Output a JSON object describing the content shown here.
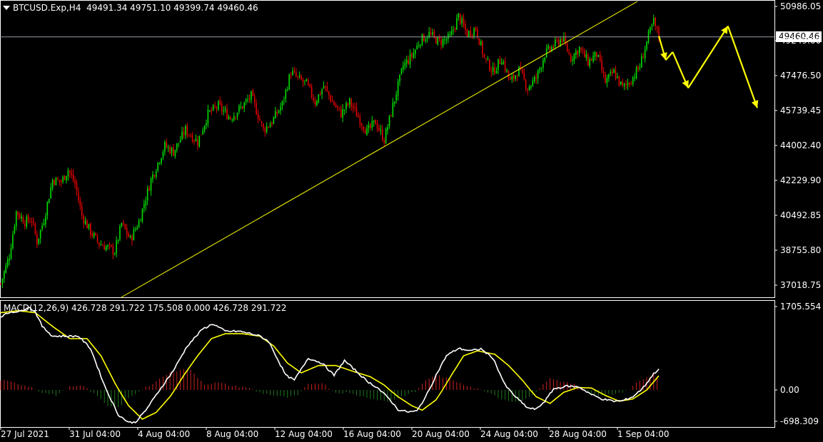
{
  "header": {
    "symbol": "BTCUSD.Exp,H4",
    "ohlc": "49491.34 49751.10 49399.74 49460.46"
  },
  "current_price_label": "49460.46",
  "macd_header": "MACD(12,26,9) 426.728 291.722 175.508 0.000 426.728 291.722",
  "colors": {
    "background": "#000000",
    "bull_candle": "#00e000",
    "bear_candle": "#e00000",
    "trendline": "#ffff00",
    "forecast_arrow": "#ffff00",
    "macd_line": "#ffffff",
    "signal_line": "#ffff00",
    "hist_up": "#cc2222",
    "hist_down": "#1e7a1e",
    "grid_border": "#ffffff"
  },
  "chart_data": [
    {
      "type": "candlestick",
      "title": "BTCUSD.Exp,H4",
      "timeframe": "H4",
      "y_ticks": [
        "50986.05",
        "49249.00",
        "47476.50",
        "45739.45",
        "44002.40",
        "42229.90",
        "40492.85",
        "38755.80",
        "37018.75"
      ],
      "ylim": [
        36600,
        51200
      ],
      "x_ticks": [
        "27 Jul 2021",
        "31 Jul 04:00",
        "4 Aug 04:00",
        "8 Aug 04:00",
        "12 Aug 04:00",
        "16 Aug 04:00",
        "20 Aug 04:00",
        "24 Aug 04:00",
        "28 Aug 04:00",
        "1 Sep 04:00"
      ],
      "anchor_closes": [
        [
          0,
          37100
        ],
        [
          5,
          38500
        ],
        [
          9,
          40700
        ],
        [
          14,
          40200
        ],
        [
          18,
          40300
        ],
        [
          21,
          39200
        ],
        [
          25,
          40300
        ],
        [
          30,
          42300
        ],
        [
          35,
          42200
        ],
        [
          39,
          42800
        ],
        [
          43,
          42100
        ],
        [
          47,
          40500
        ],
        [
          52,
          39700
        ],
        [
          57,
          39100
        ],
        [
          62,
          38900
        ],
        [
          66,
          38700
        ],
        [
          70,
          40100
        ],
        [
          75,
          39300
        ],
        [
          80,
          40200
        ],
        [
          87,
          42300
        ],
        [
          95,
          44000
        ],
        [
          100,
          43700
        ],
        [
          107,
          44800
        ],
        [
          114,
          44200
        ],
        [
          120,
          45600
        ],
        [
          126,
          46000
        ],
        [
          133,
          45400
        ],
        [
          140,
          46000
        ],
        [
          145,
          46500
        ],
        [
          152,
          44800
        ],
        [
          157,
          45200
        ],
        [
          163,
          46100
        ],
        [
          168,
          47700
        ],
        [
          173,
          47300
        ],
        [
          177,
          47100
        ],
        [
          182,
          46200
        ],
        [
          187,
          47000
        ],
        [
          192,
          46200
        ],
        [
          197,
          45600
        ],
        [
          202,
          46200
        ],
        [
          206,
          45600
        ],
        [
          212,
          44700
        ],
        [
          217,
          45200
        ],
        [
          222,
          44300
        ],
        [
          227,
          46000
        ],
        [
          233,
          48000
        ],
        [
          238,
          48500
        ],
        [
          243,
          49300
        ],
        [
          248,
          49600
        ],
        [
          254,
          49200
        ],
        [
          260,
          49400
        ],
        [
          265,
          50500
        ],
        [
          270,
          49600
        ],
        [
          275,
          49900
        ],
        [
          280,
          48400
        ],
        [
          285,
          47700
        ],
        [
          290,
          48400
        ],
        [
          295,
          47200
        ],
        [
          300,
          47800
        ],
        [
          305,
          46900
        ],
        [
          310,
          47400
        ],
        [
          315,
          48600
        ],
        [
          320,
          49000
        ],
        [
          325,
          49400
        ],
        [
          330,
          48400
        ],
        [
          335,
          48900
        ],
        [
          340,
          48200
        ],
        [
          345,
          48600
        ],
        [
          350,
          47200
        ],
        [
          355,
          47700
        ],
        [
          360,
          46900
        ],
        [
          365,
          47300
        ],
        [
          370,
          48000
        ],
        [
          375,
          49500
        ],
        [
          378,
          50200
        ],
        [
          381,
          49460
        ]
      ],
      "trendline": {
        "from": [
          "27 Jul 2021",
          36400
        ],
        "to": [
          "1 Sep 04:00",
          51500
        ]
      },
      "forecast_path": [
        [
          381,
          49500
        ],
        [
          385,
          48300
        ],
        [
          389,
          48700
        ],
        [
          398,
          46900
        ],
        [
          421,
          50000
        ],
        [
          438,
          45900
        ]
      ]
    },
    {
      "type": "line",
      "title": "MACD(12,26,9)",
      "y_ticks": [
        "1705.554",
        "0.00",
        "-698.309"
      ],
      "ylim": [
        -760,
        1760
      ],
      "series": [
        {
          "name": "MACD",
          "anchors": [
            [
              0,
              1500
            ],
            [
              6,
              1600
            ],
            [
              11,
              1600
            ],
            [
              16,
              1700
            ],
            [
              20,
              1600
            ],
            [
              24,
              1300
            ],
            [
              30,
              1100
            ],
            [
              38,
              1100
            ],
            [
              45,
              1100
            ],
            [
              52,
              850
            ],
            [
              60,
              100
            ],
            [
              68,
              -550
            ],
            [
              74,
              -720
            ],
            [
              78,
              -720
            ],
            [
              84,
              -450
            ],
            [
              92,
              0
            ],
            [
              100,
              400
            ],
            [
              108,
              900
            ],
            [
              117,
              1250
            ],
            [
              123,
              1350
            ],
            [
              130,
              1200
            ],
            [
              138,
              1200
            ],
            [
              145,
              1150
            ],
            [
              150,
              1100
            ],
            [
              155,
              1000
            ],
            [
              160,
              650
            ],
            [
              165,
              300
            ],
            [
              170,
              200
            ],
            [
              178,
              650
            ],
            [
              186,
              550
            ],
            [
              193,
              300
            ],
            [
              199,
              600
            ],
            [
              206,
              380
            ],
            [
              212,
              180
            ],
            [
              218,
              50
            ],
            [
              225,
              -200
            ],
            [
              230,
              -440
            ],
            [
              236,
              -490
            ],
            [
              241,
              -470
            ],
            [
              246,
              -150
            ],
            [
              252,
              300
            ],
            [
              258,
              700
            ],
            [
              265,
              850
            ],
            [
              272,
              800
            ],
            [
              278,
              840
            ],
            [
              285,
              650
            ],
            [
              292,
              100
            ],
            [
              298,
              -150
            ],
            [
              305,
              -400
            ],
            [
              310,
              -430
            ],
            [
              315,
              -250
            ],
            [
              320,
              20
            ],
            [
              328,
              80
            ],
            [
              335,
              60
            ],
            [
              342,
              -100
            ],
            [
              348,
              -200
            ],
            [
              355,
              -250
            ],
            [
              360,
              -240
            ],
            [
              366,
              -150
            ],
            [
              372,
              50
            ],
            [
              378,
              330
            ],
            [
              381,
              430
            ]
          ]
        },
        {
          "name": "Signal",
          "anchors": [
            [
              0,
              1580
            ],
            [
              10,
              1620
            ],
            [
              20,
              1580
            ],
            [
              30,
              1300
            ],
            [
              40,
              1050
            ],
            [
              50,
              1050
            ],
            [
              58,
              700
            ],
            [
              66,
              150
            ],
            [
              74,
              -350
            ],
            [
              82,
              -650
            ],
            [
              90,
              -500
            ],
            [
              98,
              -150
            ],
            [
              106,
              300
            ],
            [
              114,
              700
            ],
            [
              122,
              1050
            ],
            [
              130,
              1150
            ],
            [
              140,
              1150
            ],
            [
              150,
              1100
            ],
            [
              158,
              900
            ],
            [
              166,
              550
            ],
            [
              174,
              350
            ],
            [
              184,
              500
            ],
            [
              194,
              500
            ],
            [
              204,
              380
            ],
            [
              214,
              270
            ],
            [
              222,
              100
            ],
            [
              230,
              -150
            ],
            [
              238,
              -350
            ],
            [
              244,
              -450
            ],
            [
              252,
              -220
            ],
            [
              260,
              250
            ],
            [
              268,
              700
            ],
            [
              276,
              800
            ],
            [
              286,
              730
            ],
            [
              294,
              500
            ],
            [
              302,
              200
            ],
            [
              310,
              -150
            ],
            [
              318,
              -300
            ],
            [
              326,
              -50
            ],
            [
              334,
              50
            ],
            [
              342,
              40
            ],
            [
              350,
              -120
            ],
            [
              358,
              -250
            ],
            [
              366,
              -200
            ],
            [
              374,
              0
            ],
            [
              381,
              290
            ]
          ]
        },
        {
          "name": "Histogram",
          "anchors": [
            [
              0,
              200
            ],
            [
              10,
              130
            ],
            [
              18,
              60
            ],
            [
              24,
              -60
            ],
            [
              32,
              -120
            ],
            [
              40,
              60
            ],
            [
              48,
              80
            ],
            [
              56,
              -140
            ],
            [
              62,
              -350
            ],
            [
              68,
              -390
            ],
            [
              74,
              -200
            ],
            [
              80,
              -40
            ],
            [
              88,
              140
            ],
            [
              96,
              320
            ],
            [
              104,
              420
            ],
            [
              110,
              400
            ],
            [
              118,
              120
            ],
            [
              126,
              150
            ],
            [
              134,
              80
            ],
            [
              142,
              60
            ],
            [
              150,
              -60
            ],
            [
              158,
              -120
            ],
            [
              166,
              -170
            ],
            [
              172,
              -120
            ],
            [
              178,
              120
            ],
            [
              186,
              150
            ],
            [
              194,
              -60
            ],
            [
              200,
              -60
            ],
            [
              208,
              -130
            ],
            [
              216,
              -200
            ],
            [
              224,
              -260
            ],
            [
              232,
              -150
            ],
            [
              240,
              -40
            ],
            [
              246,
              200
            ],
            [
              252,
              320
            ],
            [
              258,
              240
            ],
            [
              266,
              150
            ],
            [
              274,
              40
            ],
            [
              282,
              -40
            ],
            [
              290,
              -200
            ],
            [
              298,
              -270
            ],
            [
              306,
              -170
            ],
            [
              312,
              40
            ],
            [
              318,
              240
            ],
            [
              324,
              180
            ],
            [
              332,
              120
            ],
            [
              340,
              -80
            ],
            [
              348,
              -130
            ],
            [
              356,
              -80
            ],
            [
              362,
              -30
            ],
            [
              368,
              140
            ],
            [
              374,
              260
            ],
            [
              378,
              320
            ],
            [
              381,
              220
            ]
          ]
        }
      ]
    }
  ]
}
